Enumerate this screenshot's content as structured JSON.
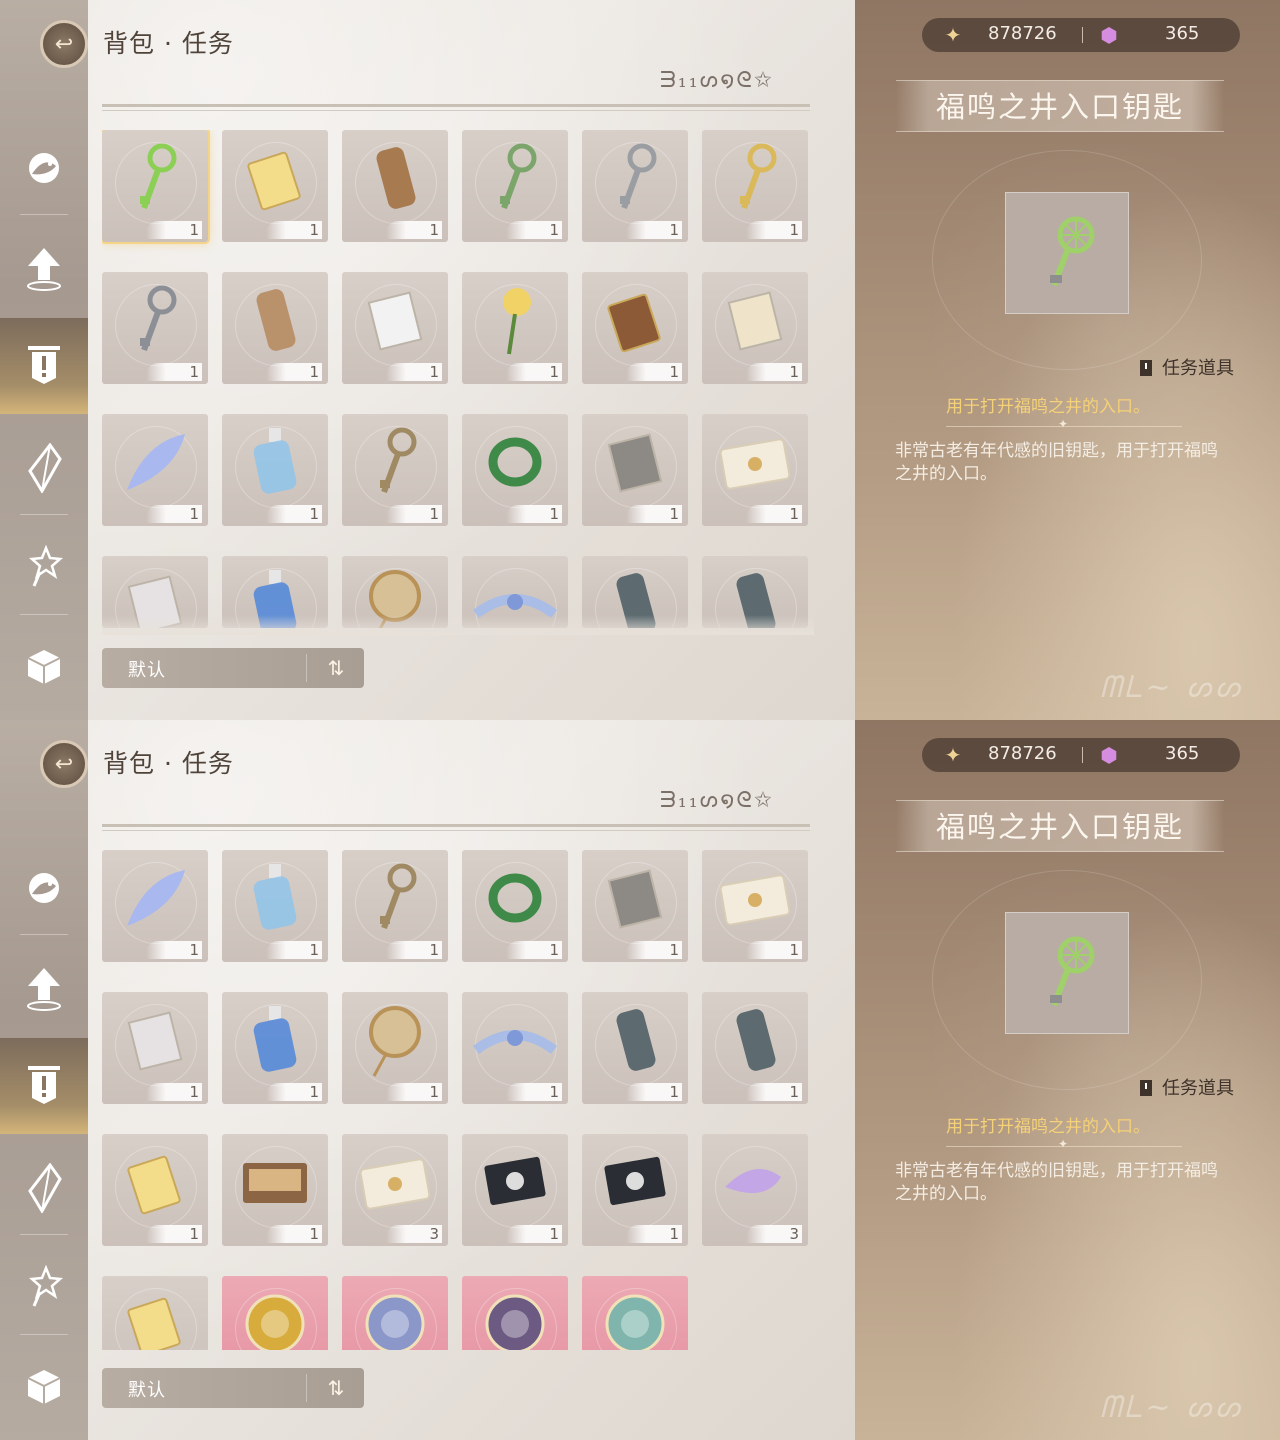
{
  "header": {
    "title": "背包 · 任务",
    "deco_text": "ᗱ₁₁ᔕ໑ᘓ✩",
    "back_icon": "back-arrow-icon"
  },
  "sidebar": {
    "items": [
      {
        "name": "fish",
        "icon": "fish-icon"
      },
      {
        "name": "upgrade",
        "icon": "up-arrow-icon"
      },
      {
        "name": "quest",
        "icon": "exclamation-icon",
        "active": true
      },
      {
        "name": "crystal",
        "icon": "crystal-icon"
      },
      {
        "name": "star",
        "icon": "star-wand-icon"
      },
      {
        "name": "box",
        "icon": "cube-icon"
      }
    ]
  },
  "currency": {
    "gold_value": "878726",
    "gem_value": "365"
  },
  "detail": {
    "name": "福鸣之井入口钥匙",
    "type": "任务道具",
    "use": "用于打开福鸣之井的入口。",
    "description": "非常古老有年代感的旧钥匙，用于打开福鸣之井的入口。"
  },
  "sort": {
    "label": "默认",
    "icon": "sort-toggle-icon"
  },
  "panel1": {
    "items": [
      {
        "icon": "green-key",
        "count": "1",
        "selected": true
      },
      {
        "icon": "yellow-book",
        "count": "1"
      },
      {
        "icon": "brown-scroll-tube",
        "count": "1"
      },
      {
        "icon": "ornate-green-key",
        "count": "1"
      },
      {
        "icon": "silver-key",
        "count": "1"
      },
      {
        "icon": "gold-heart-key",
        "count": "1"
      },
      {
        "icon": "grey-key",
        "count": "1"
      },
      {
        "icon": "paper-scroll-tube",
        "count": "1"
      },
      {
        "icon": "torn-paper",
        "count": "1"
      },
      {
        "icon": "yellow-rose",
        "count": "1"
      },
      {
        "icon": "brown-notebook",
        "count": "1"
      },
      {
        "icon": "music-sheet",
        "count": "1"
      },
      {
        "icon": "blue-feather",
        "count": "1"
      },
      {
        "icon": "water-bottle",
        "count": "1"
      },
      {
        "icon": "bronze-key",
        "count": "1"
      },
      {
        "icon": "green-bracelet",
        "count": "1"
      },
      {
        "icon": "grey-document",
        "count": "1"
      },
      {
        "icon": "sealed-envelope",
        "count": "1"
      },
      {
        "icon": "letters",
        "count": ""
      },
      {
        "icon": "blue-potion",
        "count": ""
      },
      {
        "icon": "round-fan",
        "count": ""
      },
      {
        "icon": "blue-flower-crown",
        "count": ""
      },
      {
        "icon": "scroll-roll",
        "count": ""
      },
      {
        "icon": "scroll-roll",
        "count": ""
      }
    ]
  },
  "panel2": {
    "items": [
      {
        "icon": "blue-feather",
        "count": "1"
      },
      {
        "icon": "water-bottle",
        "count": "1"
      },
      {
        "icon": "bronze-key",
        "count": "1"
      },
      {
        "icon": "green-bracelet",
        "count": "1"
      },
      {
        "icon": "grey-document",
        "count": "1"
      },
      {
        "icon": "sealed-envelope",
        "count": "1"
      },
      {
        "icon": "letters",
        "count": "1"
      },
      {
        "icon": "blue-potion",
        "count": "1"
      },
      {
        "icon": "round-fan",
        "count": "1"
      },
      {
        "icon": "blue-flower-crown",
        "count": "1"
      },
      {
        "icon": "scroll-roll",
        "count": "1"
      },
      {
        "icon": "scroll-roll",
        "count": "1"
      },
      {
        "icon": "yellow-book",
        "count": "1"
      },
      {
        "icon": "tool-case",
        "count": "1"
      },
      {
        "icon": "sealed-envelope",
        "count": "3"
      },
      {
        "icon": "black-emblem-card",
        "count": "1"
      },
      {
        "icon": "black-emblem-card",
        "count": "1"
      },
      {
        "icon": "purple-fish",
        "count": "3"
      },
      {
        "icon": "yellow-book",
        "count": ""
      },
      {
        "icon": "gold-lyre-badge",
        "count": "",
        "pink": true
      },
      {
        "icon": "silver-wolf-badge",
        "count": "",
        "pink": true
      },
      {
        "icon": "purple-gem-badge",
        "count": "",
        "pink": true
      },
      {
        "icon": "butterfly-badge",
        "count": "",
        "pink": true
      }
    ]
  },
  "colors": {
    "accent_gold": "#f5d177",
    "rare_pink": "#e590a0",
    "selected_glow": "#f3d488"
  }
}
